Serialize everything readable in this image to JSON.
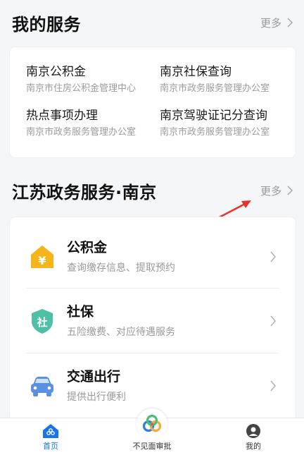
{
  "my_services": {
    "title": "我的服务",
    "more": "更多",
    "items": [
      {
        "name": "南京公积金",
        "org": "南京市住房公积金管理中心"
      },
      {
        "name": "南京社保查询",
        "org": "南京市政务服务管理办公室"
      },
      {
        "name": "热点事项办理",
        "org": "南京市政务服务管理办公室"
      },
      {
        "name": "南京驾驶证记分查询",
        "org": "南京市政务服务管理办公室"
      }
    ]
  },
  "jiangsu": {
    "title": "江苏政务服务·南京",
    "more": "更多",
    "items": [
      {
        "title": "公积金",
        "desc": "查询缴存信息、提取预约",
        "icon": "yuan-house-icon"
      },
      {
        "title": "社保",
        "desc": "五险缴费、对应待遇服务",
        "icon": "shield-icon"
      },
      {
        "title": "交通出行",
        "desc": "提供出行便利",
        "icon": "car-icon"
      }
    ]
  },
  "tabbar": {
    "tabs": [
      {
        "label": "首页",
        "icon": "home-icon",
        "active": true
      },
      {
        "label": "不见面审批",
        "icon": "approval-logo-icon",
        "active": false
      },
      {
        "label": "我的",
        "icon": "profile-icon",
        "active": false
      }
    ]
  },
  "colors": {
    "accent": "#1b73e8",
    "arrow": "#e8322b",
    "yuan": "#f5b51a",
    "shield": "#4fc0a6",
    "car": "#5a8fe3"
  }
}
